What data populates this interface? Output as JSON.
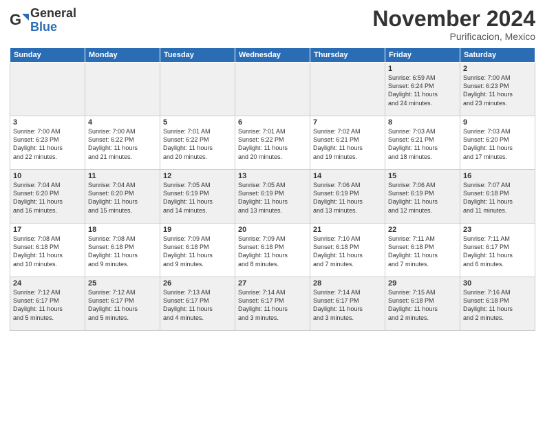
{
  "header": {
    "logo_general": "General",
    "logo_blue": "Blue",
    "month_title": "November 2024",
    "location": "Purificacion, Mexico"
  },
  "weekdays": [
    "Sunday",
    "Monday",
    "Tuesday",
    "Wednesday",
    "Thursday",
    "Friday",
    "Saturday"
  ],
  "weeks": [
    [
      {
        "day": "",
        "detail": ""
      },
      {
        "day": "",
        "detail": ""
      },
      {
        "day": "",
        "detail": ""
      },
      {
        "day": "",
        "detail": ""
      },
      {
        "day": "",
        "detail": ""
      },
      {
        "day": "1",
        "detail": "Sunrise: 6:59 AM\nSunset: 6:24 PM\nDaylight: 11 hours\nand 24 minutes."
      },
      {
        "day": "2",
        "detail": "Sunrise: 7:00 AM\nSunset: 6:23 PM\nDaylight: 11 hours\nand 23 minutes."
      }
    ],
    [
      {
        "day": "3",
        "detail": "Sunrise: 7:00 AM\nSunset: 6:23 PM\nDaylight: 11 hours\nand 22 minutes."
      },
      {
        "day": "4",
        "detail": "Sunrise: 7:00 AM\nSunset: 6:22 PM\nDaylight: 11 hours\nand 21 minutes."
      },
      {
        "day": "5",
        "detail": "Sunrise: 7:01 AM\nSunset: 6:22 PM\nDaylight: 11 hours\nand 20 minutes."
      },
      {
        "day": "6",
        "detail": "Sunrise: 7:01 AM\nSunset: 6:22 PM\nDaylight: 11 hours\nand 20 minutes."
      },
      {
        "day": "7",
        "detail": "Sunrise: 7:02 AM\nSunset: 6:21 PM\nDaylight: 11 hours\nand 19 minutes."
      },
      {
        "day": "8",
        "detail": "Sunrise: 7:03 AM\nSunset: 6:21 PM\nDaylight: 11 hours\nand 18 minutes."
      },
      {
        "day": "9",
        "detail": "Sunrise: 7:03 AM\nSunset: 6:20 PM\nDaylight: 11 hours\nand 17 minutes."
      }
    ],
    [
      {
        "day": "10",
        "detail": "Sunrise: 7:04 AM\nSunset: 6:20 PM\nDaylight: 11 hours\nand 16 minutes."
      },
      {
        "day": "11",
        "detail": "Sunrise: 7:04 AM\nSunset: 6:20 PM\nDaylight: 11 hours\nand 15 minutes."
      },
      {
        "day": "12",
        "detail": "Sunrise: 7:05 AM\nSunset: 6:19 PM\nDaylight: 11 hours\nand 14 minutes."
      },
      {
        "day": "13",
        "detail": "Sunrise: 7:05 AM\nSunset: 6:19 PM\nDaylight: 11 hours\nand 13 minutes."
      },
      {
        "day": "14",
        "detail": "Sunrise: 7:06 AM\nSunset: 6:19 PM\nDaylight: 11 hours\nand 13 minutes."
      },
      {
        "day": "15",
        "detail": "Sunrise: 7:06 AM\nSunset: 6:19 PM\nDaylight: 11 hours\nand 12 minutes."
      },
      {
        "day": "16",
        "detail": "Sunrise: 7:07 AM\nSunset: 6:18 PM\nDaylight: 11 hours\nand 11 minutes."
      }
    ],
    [
      {
        "day": "17",
        "detail": "Sunrise: 7:08 AM\nSunset: 6:18 PM\nDaylight: 11 hours\nand 10 minutes."
      },
      {
        "day": "18",
        "detail": "Sunrise: 7:08 AM\nSunset: 6:18 PM\nDaylight: 11 hours\nand 9 minutes."
      },
      {
        "day": "19",
        "detail": "Sunrise: 7:09 AM\nSunset: 6:18 PM\nDaylight: 11 hours\nand 9 minutes."
      },
      {
        "day": "20",
        "detail": "Sunrise: 7:09 AM\nSunset: 6:18 PM\nDaylight: 11 hours\nand 8 minutes."
      },
      {
        "day": "21",
        "detail": "Sunrise: 7:10 AM\nSunset: 6:18 PM\nDaylight: 11 hours\nand 7 minutes."
      },
      {
        "day": "22",
        "detail": "Sunrise: 7:11 AM\nSunset: 6:18 PM\nDaylight: 11 hours\nand 7 minutes."
      },
      {
        "day": "23",
        "detail": "Sunrise: 7:11 AM\nSunset: 6:17 PM\nDaylight: 11 hours\nand 6 minutes."
      }
    ],
    [
      {
        "day": "24",
        "detail": "Sunrise: 7:12 AM\nSunset: 6:17 PM\nDaylight: 11 hours\nand 5 minutes."
      },
      {
        "day": "25",
        "detail": "Sunrise: 7:12 AM\nSunset: 6:17 PM\nDaylight: 11 hours\nand 5 minutes."
      },
      {
        "day": "26",
        "detail": "Sunrise: 7:13 AM\nSunset: 6:17 PM\nDaylight: 11 hours\nand 4 minutes."
      },
      {
        "day": "27",
        "detail": "Sunrise: 7:14 AM\nSunset: 6:17 PM\nDaylight: 11 hours\nand 3 minutes."
      },
      {
        "day": "28",
        "detail": "Sunrise: 7:14 AM\nSunset: 6:17 PM\nDaylight: 11 hours\nand 3 minutes."
      },
      {
        "day": "29",
        "detail": "Sunrise: 7:15 AM\nSunset: 6:18 PM\nDaylight: 11 hours\nand 2 minutes."
      },
      {
        "day": "30",
        "detail": "Sunrise: 7:16 AM\nSunset: 6:18 PM\nDaylight: 11 hours\nand 2 minutes."
      }
    ]
  ]
}
